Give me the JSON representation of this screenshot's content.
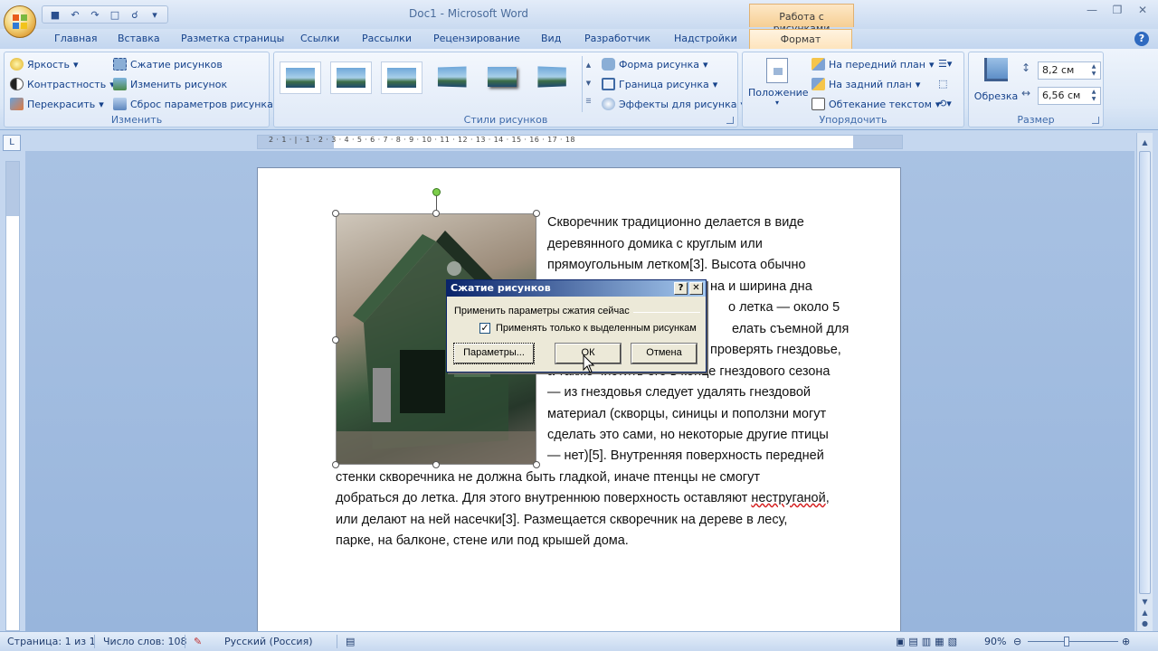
{
  "window": {
    "title": "Doc1 - Microsoft Word",
    "context_tab_group": "Работа с рисунками"
  },
  "tabs": [
    "Главная",
    "Вставка",
    "Разметка страницы",
    "Ссылки",
    "Рассылки",
    "Рецензирование",
    "Вид",
    "Разработчик",
    "Надстройки"
  ],
  "active_tab": "Формат",
  "ribbon": {
    "adjust": {
      "label": "Изменить",
      "brightness": "Яркость",
      "contrast": "Контрастность",
      "recolor": "Перекрасить",
      "compress": "Сжатие рисунков",
      "change": "Изменить рисунок",
      "reset": "Сброс параметров рисунка"
    },
    "styles": {
      "label": "Стили рисунков",
      "shape": "Форма рисунка",
      "border": "Граница рисунка",
      "effects": "Эффекты для рисунка"
    },
    "arrange": {
      "label": "Упорядочить",
      "position": "Положение",
      "front": "На передний план",
      "back": "На задний план",
      "wrap": "Обтекание текстом"
    },
    "size": {
      "label": "Размер",
      "crop": "Обрезка",
      "height": "8,2 см",
      "width": "6,56 см"
    }
  },
  "ruler": {
    "marks": "2 · 1 · | · 1 · 2 · 3 · 4 · 5 · 6 · 7 · 8 · 9 · 10 · 11 · 12 · 13 · 14 · 15 · 16 · 17 · 18"
  },
  "document": {
    "lines_right": [
      "Скворечник традиционно делается в виде",
      "деревянного домика с круглым или",
      "прямоугольным летком[3]. Высота обычно",
      "на и ширина дна",
      "о летка — около 5",
      "елать съемной для",
      "проверять гнездовье,",
      "а также чистить его в конце гнездового сезона",
      "— из гнездовья следует удалять гнездовой",
      "материал (скворцы, синицы и поползни могут",
      "сделать это сами, но некоторые другие птицы",
      "— нет)[5]. Внутренняя поверхность передней"
    ],
    "lines_full": [
      "стенки скворечника не должна быть гладкой, иначе птенцы не смогут",
      "до летка. Для этого внутреннюю поверхность оставляют",
      "или делают на ней насечки[3]. Размещается скворечник на дереве в лесу,",
      "парке, на балконе, стене или под крышей дома."
    ],
    "line14_prefix": "добраться",
    "line14_misspelled": "неструганой",
    "line14_suffix": ","
  },
  "dialog": {
    "title": "Сжатие рисунков",
    "help": "?",
    "close": "✕",
    "group_label": "Применить параметры сжатия сейчас",
    "checkbox_label": "Применять только к выделенным рисункам",
    "checkbox_checked": true,
    "params_button": "Параметры...",
    "ok_button": "ОК",
    "cancel_button": "Отмена"
  },
  "statusbar": {
    "page": "Страница: 1 из 1",
    "words": "Число слов: 108",
    "language": "Русский (Россия)",
    "zoom": "90%"
  },
  "colors": {
    "ribbon_accent": "#15428b",
    "context_tab": "#f6cf94",
    "dialog_title": "#0a246a"
  }
}
